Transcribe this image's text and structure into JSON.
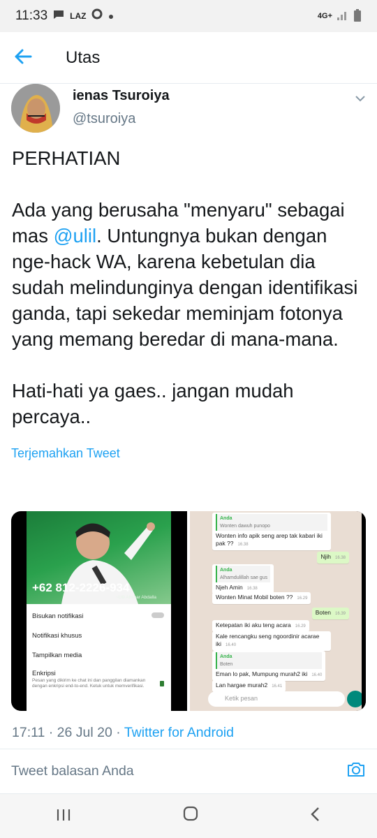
{
  "status_bar": {
    "time": "11:33",
    "network": "4G+"
  },
  "header": {
    "title": "Utas"
  },
  "tweet": {
    "display_name": "ienas Tsuroiya",
    "handle": "@tsuroiya",
    "text_p1": "PERHATIAN",
    "text_p2a": "Ada yang berusaha \"menyaru\" sebagai mas ",
    "mention": "@ulil",
    "text_p2b": ". Untungnya bukan dengan nge-hack WA, karena kebetulan dia sudah melindunginya dengan identifikasi ganda, tapi sekedar meminjam fotonya yang memang beredar di mana-mana.",
    "text_p3": "Hati-hati ya gaes.. jangan mudah percaya..",
    "translate": "Terjemahkan Tweet",
    "timestamp": "17:11 · 26 Jul 20 · ",
    "source": "Twitter for Android"
  },
  "media_left": {
    "phone": "+62 812-2226-934",
    "name_caption": "~Ulil Abshar Abdalla",
    "rows": [
      "Bisukan notifikasi",
      "Notifikasi khusus",
      "Tampilkan media",
      "Enkripsi"
    ],
    "encryption_desc": "Pesan yang dikirim ke chat ini dan panggilan diamankan dengan enkripsi end-to-end. Ketuk untuk memverifikasi."
  },
  "media_right": {
    "messages": [
      {
        "quote_name": "Anda",
        "quote_text": "Wonten dawuh punopo",
        "text": "Wonten info apik seng arep tak kabari iki pak ??",
        "time": "16.38",
        "out": false
      },
      {
        "text": "Njih",
        "time": "16.38",
        "out": true
      },
      {
        "quote_name": "Anda",
        "quote_text": "Alhamdulillah sae gus",
        "text": "Njeh Amin",
        "time": "16.38",
        "out": false
      },
      {
        "text": "Wonten Minat Mobil boten ??",
        "time": "16.29",
        "out": false
      },
      {
        "text": "Boten",
        "time": "16.39",
        "out": true
      },
      {
        "text": "Ketepatan iki aku teng acara",
        "time": "16.29",
        "out": false
      },
      {
        "text": "Kale rencangku seng ngoordinir acarae iki",
        "time": "16.40",
        "out": false
      },
      {
        "quote_name": "Anda",
        "quote_text": "Boten",
        "text": "Eman lo pak, Mumpung murah2 iki",
        "time": "16.40",
        "out": false
      },
      {
        "text": "Lan hargae murah2",
        "time": "16.41",
        "out": false
      }
    ],
    "input_placeholder": "Ketik pesan"
  },
  "reply": {
    "placeholder": "Tweet balasan Anda"
  },
  "icons": {
    "back": "arrow-left-icon",
    "caret": "chevron-down-icon",
    "camera": "camera-icon",
    "nav_recent": "recent-apps-icon",
    "nav_home": "home-icon",
    "nav_back": "back-icon"
  },
  "colors": {
    "accent": "#1da1f2",
    "text": "#14171a",
    "secondary": "#657786"
  }
}
